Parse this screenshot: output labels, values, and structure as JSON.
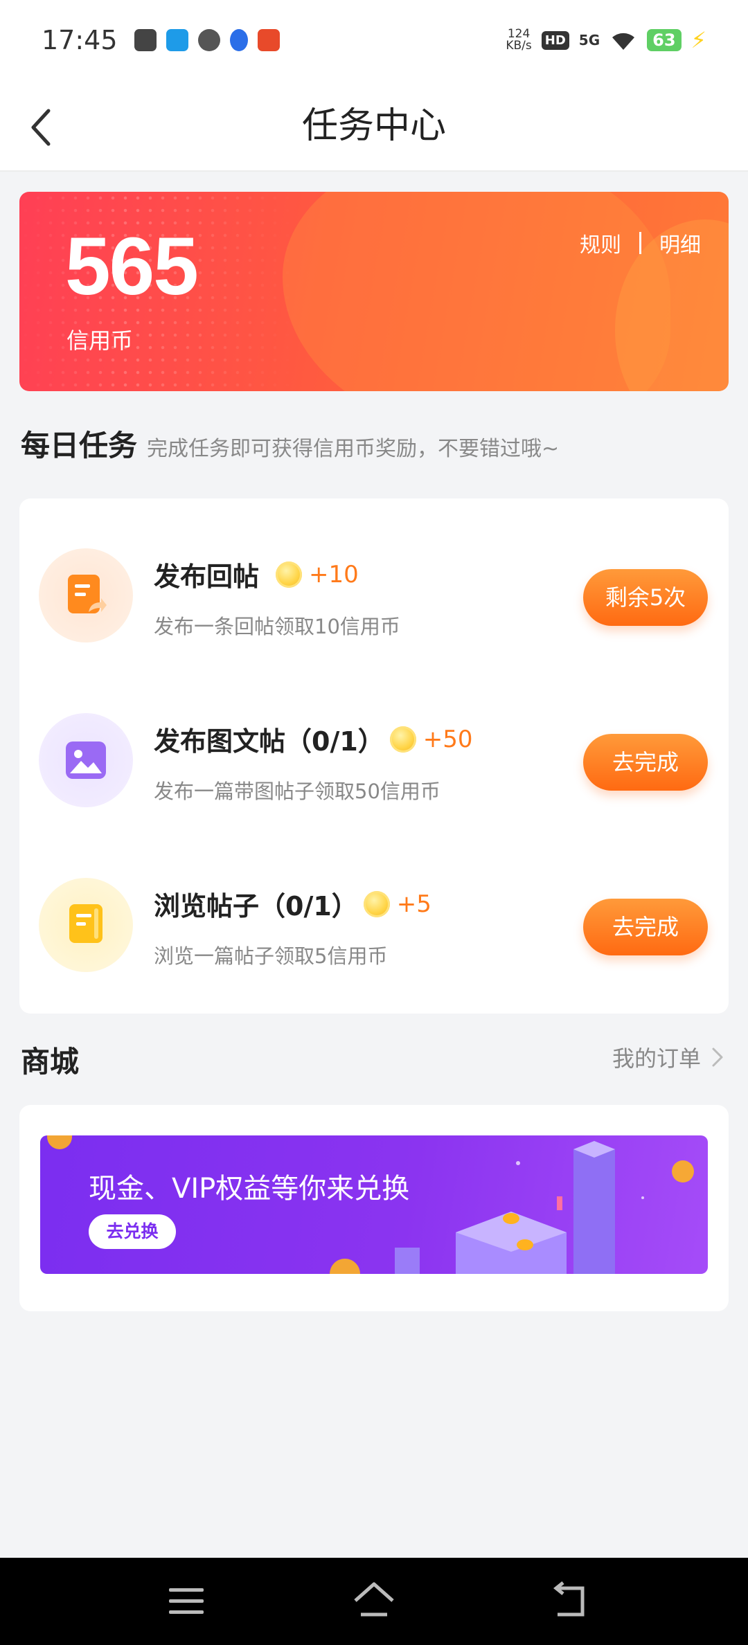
{
  "status_bar": {
    "time": "17:45",
    "speed_value": "124",
    "speed_unit": "KB/s",
    "hd": "HD",
    "network": "5G",
    "battery": "63",
    "app_icons": [
      "mail-app-icon",
      "browser-app-icon",
      "chat-bubble-icon",
      "baidu-paw-icon",
      "bank-app-icon"
    ]
  },
  "header": {
    "title": "任务中心"
  },
  "credit_banner": {
    "value": "565",
    "label": "信用币",
    "rules_link": "规则",
    "detail_link": "明细"
  },
  "daily_section": {
    "title": "每日任务",
    "subtitle": "完成任务即可获得信用币奖励，不要错过哦~"
  },
  "tasks": [
    {
      "title": "发布回帖",
      "reward": "+10",
      "desc": "发布一条回帖领取10信用币",
      "button": "剩余5次",
      "icon": "reply-post-icon"
    },
    {
      "title": "发布图文帖（0/1）",
      "reward": "+50",
      "desc": "发布一篇带图帖子领取50信用币",
      "button": "去完成",
      "icon": "image-post-icon"
    },
    {
      "title": "浏览帖子（0/1）",
      "reward": "+5",
      "desc": "浏览一篇帖子领取5信用币",
      "button": "去完成",
      "icon": "browse-post-icon"
    }
  ],
  "mall": {
    "title": "商城",
    "orders_link": "我的订单",
    "banner_text": "现金、VIP权益等你来兑换",
    "banner_button": "去兑换"
  },
  "colors": {
    "accent_orange": "#ff6a12",
    "banner_red": "#ff3f55",
    "mall_purple": "#7b2ef0"
  }
}
